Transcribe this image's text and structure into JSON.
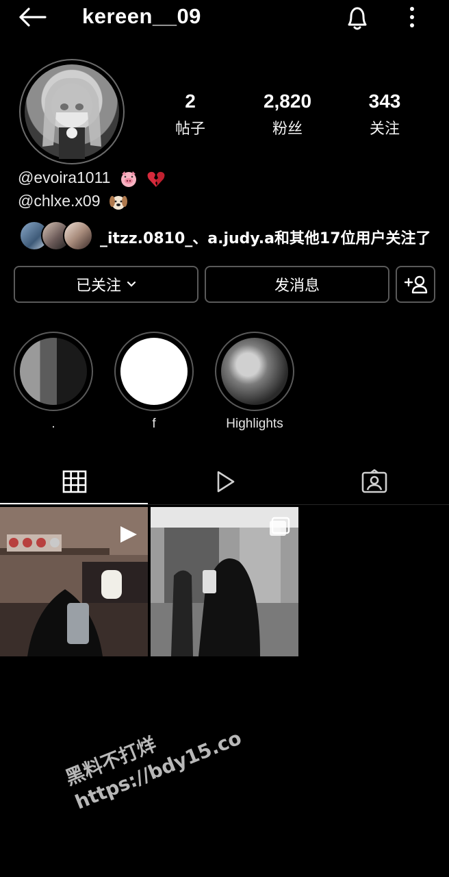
{
  "header": {
    "username": "kereen__09"
  },
  "profile": {
    "stats": [
      {
        "value": "2",
        "label": "帖子"
      },
      {
        "value": "2,820",
        "label": "粉丝"
      },
      {
        "value": "343",
        "label": "关注"
      }
    ],
    "bio": [
      {
        "text": "@evoira1011",
        "emojis": "pig-face broken-heart"
      },
      {
        "text": "@chlxe.x09",
        "emojis": "dog-face"
      }
    ],
    "followed_by_text": "_itzz.0810_、a.judy.a和其他17位用户关注了"
  },
  "actions": {
    "following_label": "已关注",
    "message_label": "发消息"
  },
  "highlights": [
    {
      "label": "."
    },
    {
      "label": "f"
    },
    {
      "label": "Highlights"
    }
  ],
  "tabs": [
    "grid-icon",
    "reels-icon",
    "tagged-icon"
  ],
  "watermark": {
    "line1": "黑料不打烊",
    "line2": "https://bdy15.co"
  }
}
